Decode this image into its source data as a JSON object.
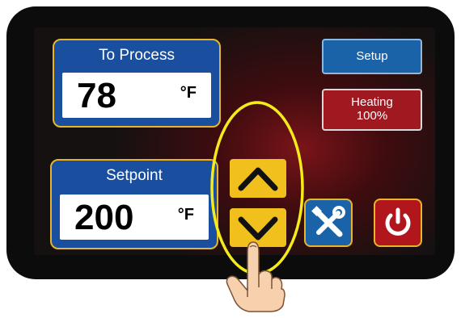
{
  "process": {
    "title": "To Process",
    "value": "78",
    "unit": "°F"
  },
  "setpoint": {
    "title": "Setpoint",
    "value": "200",
    "unit": "°F"
  },
  "buttons": {
    "setup_label": "Setup",
    "heating_line1": "Heating",
    "heating_line2": "100%"
  },
  "icons": {
    "up": "chevron-up-icon",
    "down": "chevron-down-icon",
    "tools": "tools-icon",
    "power": "power-icon",
    "hand": "pointing-hand-icon"
  },
  "colors": {
    "panel_blue": "#1a4fa0",
    "accent_yellow": "#f2c01c",
    "heating_red": "#a01820",
    "highlight_ellipse": "#f5ea1a"
  }
}
